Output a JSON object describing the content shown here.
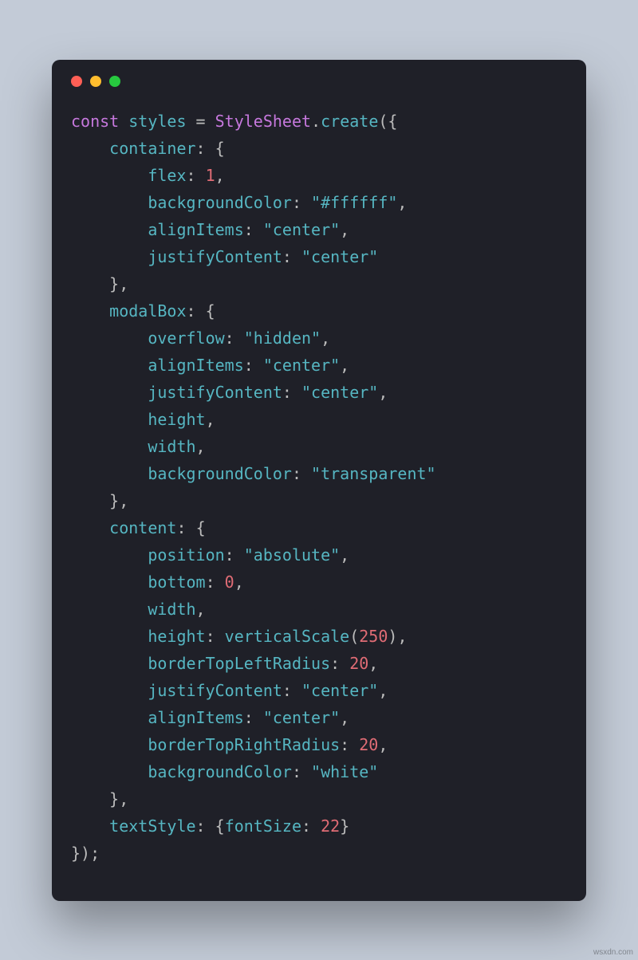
{
  "traffic_lights": [
    "red",
    "yellow",
    "green"
  ],
  "footer_mark": "wsxdn.com",
  "code": {
    "kw_const": "const",
    "var_styles": "styles",
    "eq": " = ",
    "type_StyleSheet": "StyleSheet",
    "dot": ".",
    "fn_create": "create",
    "paren_open": "(",
    "brace_open": "{",
    "brace_close": "}",
    "paren_close": ")",
    "semi": ";",
    "colon": ":",
    "comma": ",",
    "sp": " ",
    "k_container": "container",
    "k_modalBox": "modalBox",
    "k_content": "content",
    "k_textStyle": "textStyle",
    "p_flex": "flex",
    "p_backgroundColor": "backgroundColor",
    "p_alignItems": "alignItems",
    "p_justifyContent": "justifyContent",
    "p_overflow": "overflow",
    "p_height": "height",
    "p_width": "width",
    "p_position": "position",
    "p_bottom": "bottom",
    "p_borderTopLeftRadius": "borderTopLeftRadius",
    "p_borderTopRightRadius": "borderTopRightRadius",
    "p_fontSize": "fontSize",
    "s_ffffff": "\"#ffffff\"",
    "s_center": "\"center\"",
    "s_hidden": "\"hidden\"",
    "s_transparent": "\"transparent\"",
    "s_absolute": "\"absolute\"",
    "s_white": "\"white\"",
    "n_1": "1",
    "n_0": "0",
    "n_250": "250",
    "n_20": "20",
    "n_22": "22",
    "fn_verticalScale": "verticalScale"
  }
}
